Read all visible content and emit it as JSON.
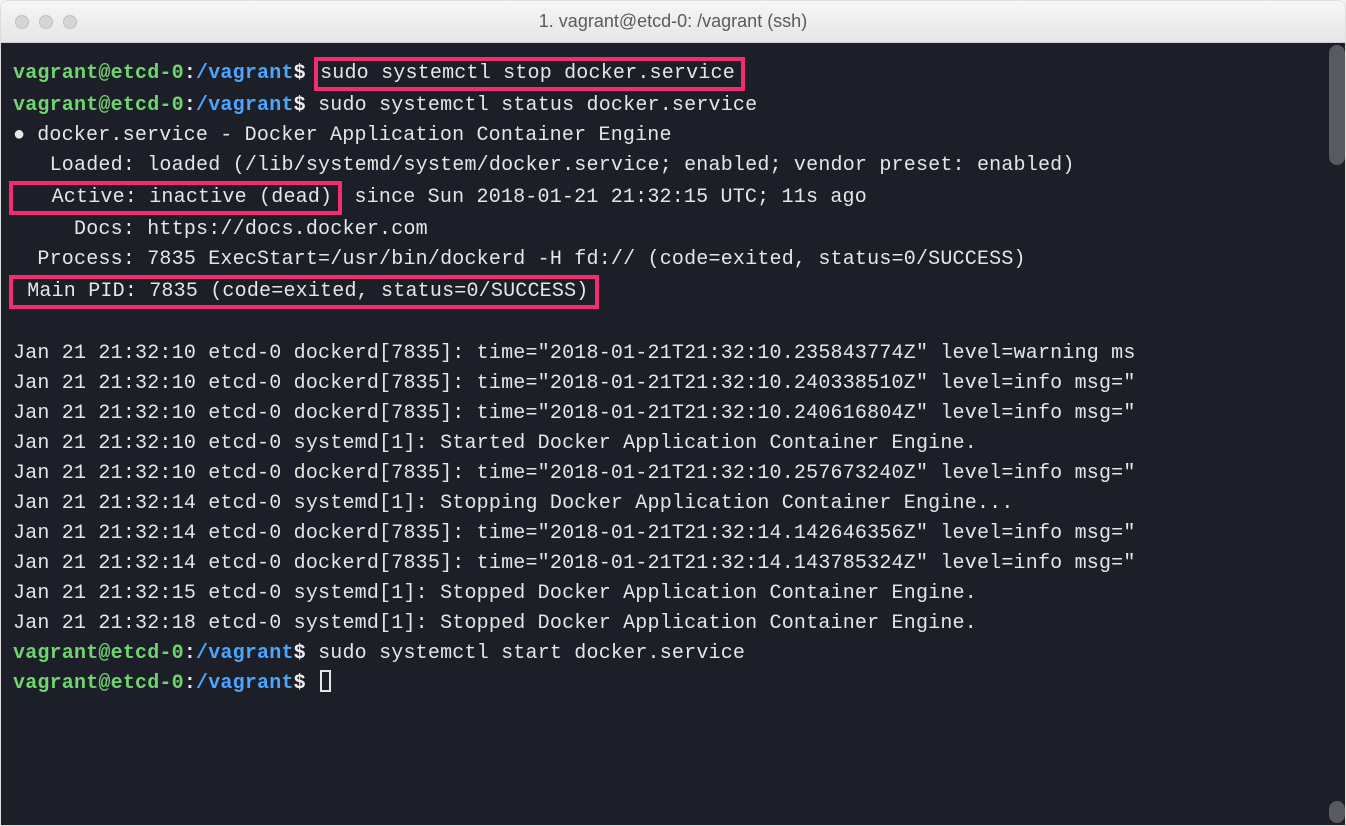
{
  "window": {
    "title": "1. vagrant@etcd-0: /vagrant (ssh)"
  },
  "prompt": {
    "user_host": "vagrant@etcd-0",
    "sep": ":",
    "path": "/vagrant",
    "sym": "$"
  },
  "commands": {
    "c1": "sudo systemctl stop docker.service",
    "c2": "sudo systemctl status docker.service",
    "c3": "sudo systemctl start docker.service"
  },
  "status": {
    "header_bullet": "●",
    "header": "docker.service - Docker Application Container Engine",
    "loaded": "   Loaded: loaded (/lib/systemd/system/docker.service; enabled; vendor preset: enabled)",
    "active_hl": "   Active: inactive (dead)",
    "active_rest": " since Sun 2018-01-21 21:32:15 UTC; 11s ago",
    "docs": "     Docs: https://docs.docker.com",
    "process": "  Process: 7835 ExecStart=/usr/bin/dockerd -H fd:// (code=exited, status=0/SUCCESS)",
    "mainpid_hl": " Main PID: 7835 (code=exited, status=0/SUCCESS)"
  },
  "logs": [
    "Jan 21 21:32:10 etcd-0 dockerd[7835]: time=\"2018-01-21T21:32:10.235843774Z\" level=warning ms",
    "Jan 21 21:32:10 etcd-0 dockerd[7835]: time=\"2018-01-21T21:32:10.240338510Z\" level=info msg=\"",
    "Jan 21 21:32:10 etcd-0 dockerd[7835]: time=\"2018-01-21T21:32:10.240616804Z\" level=info msg=\"",
    "Jan 21 21:32:10 etcd-0 systemd[1]: Started Docker Application Container Engine.",
    "Jan 21 21:32:10 etcd-0 dockerd[7835]: time=\"2018-01-21T21:32:10.257673240Z\" level=info msg=\"",
    "Jan 21 21:32:14 etcd-0 systemd[1]: Stopping Docker Application Container Engine...",
    "Jan 21 21:32:14 etcd-0 dockerd[7835]: time=\"2018-01-21T21:32:14.142646356Z\" level=info msg=\"",
    "Jan 21 21:32:14 etcd-0 dockerd[7835]: time=\"2018-01-21T21:32:14.143785324Z\" level=info msg=\"",
    "Jan 21 21:32:15 etcd-0 systemd[1]: Stopped Docker Application Container Engine.",
    "Jan 21 21:32:18 etcd-0 systemd[1]: Stopped Docker Application Container Engine."
  ]
}
